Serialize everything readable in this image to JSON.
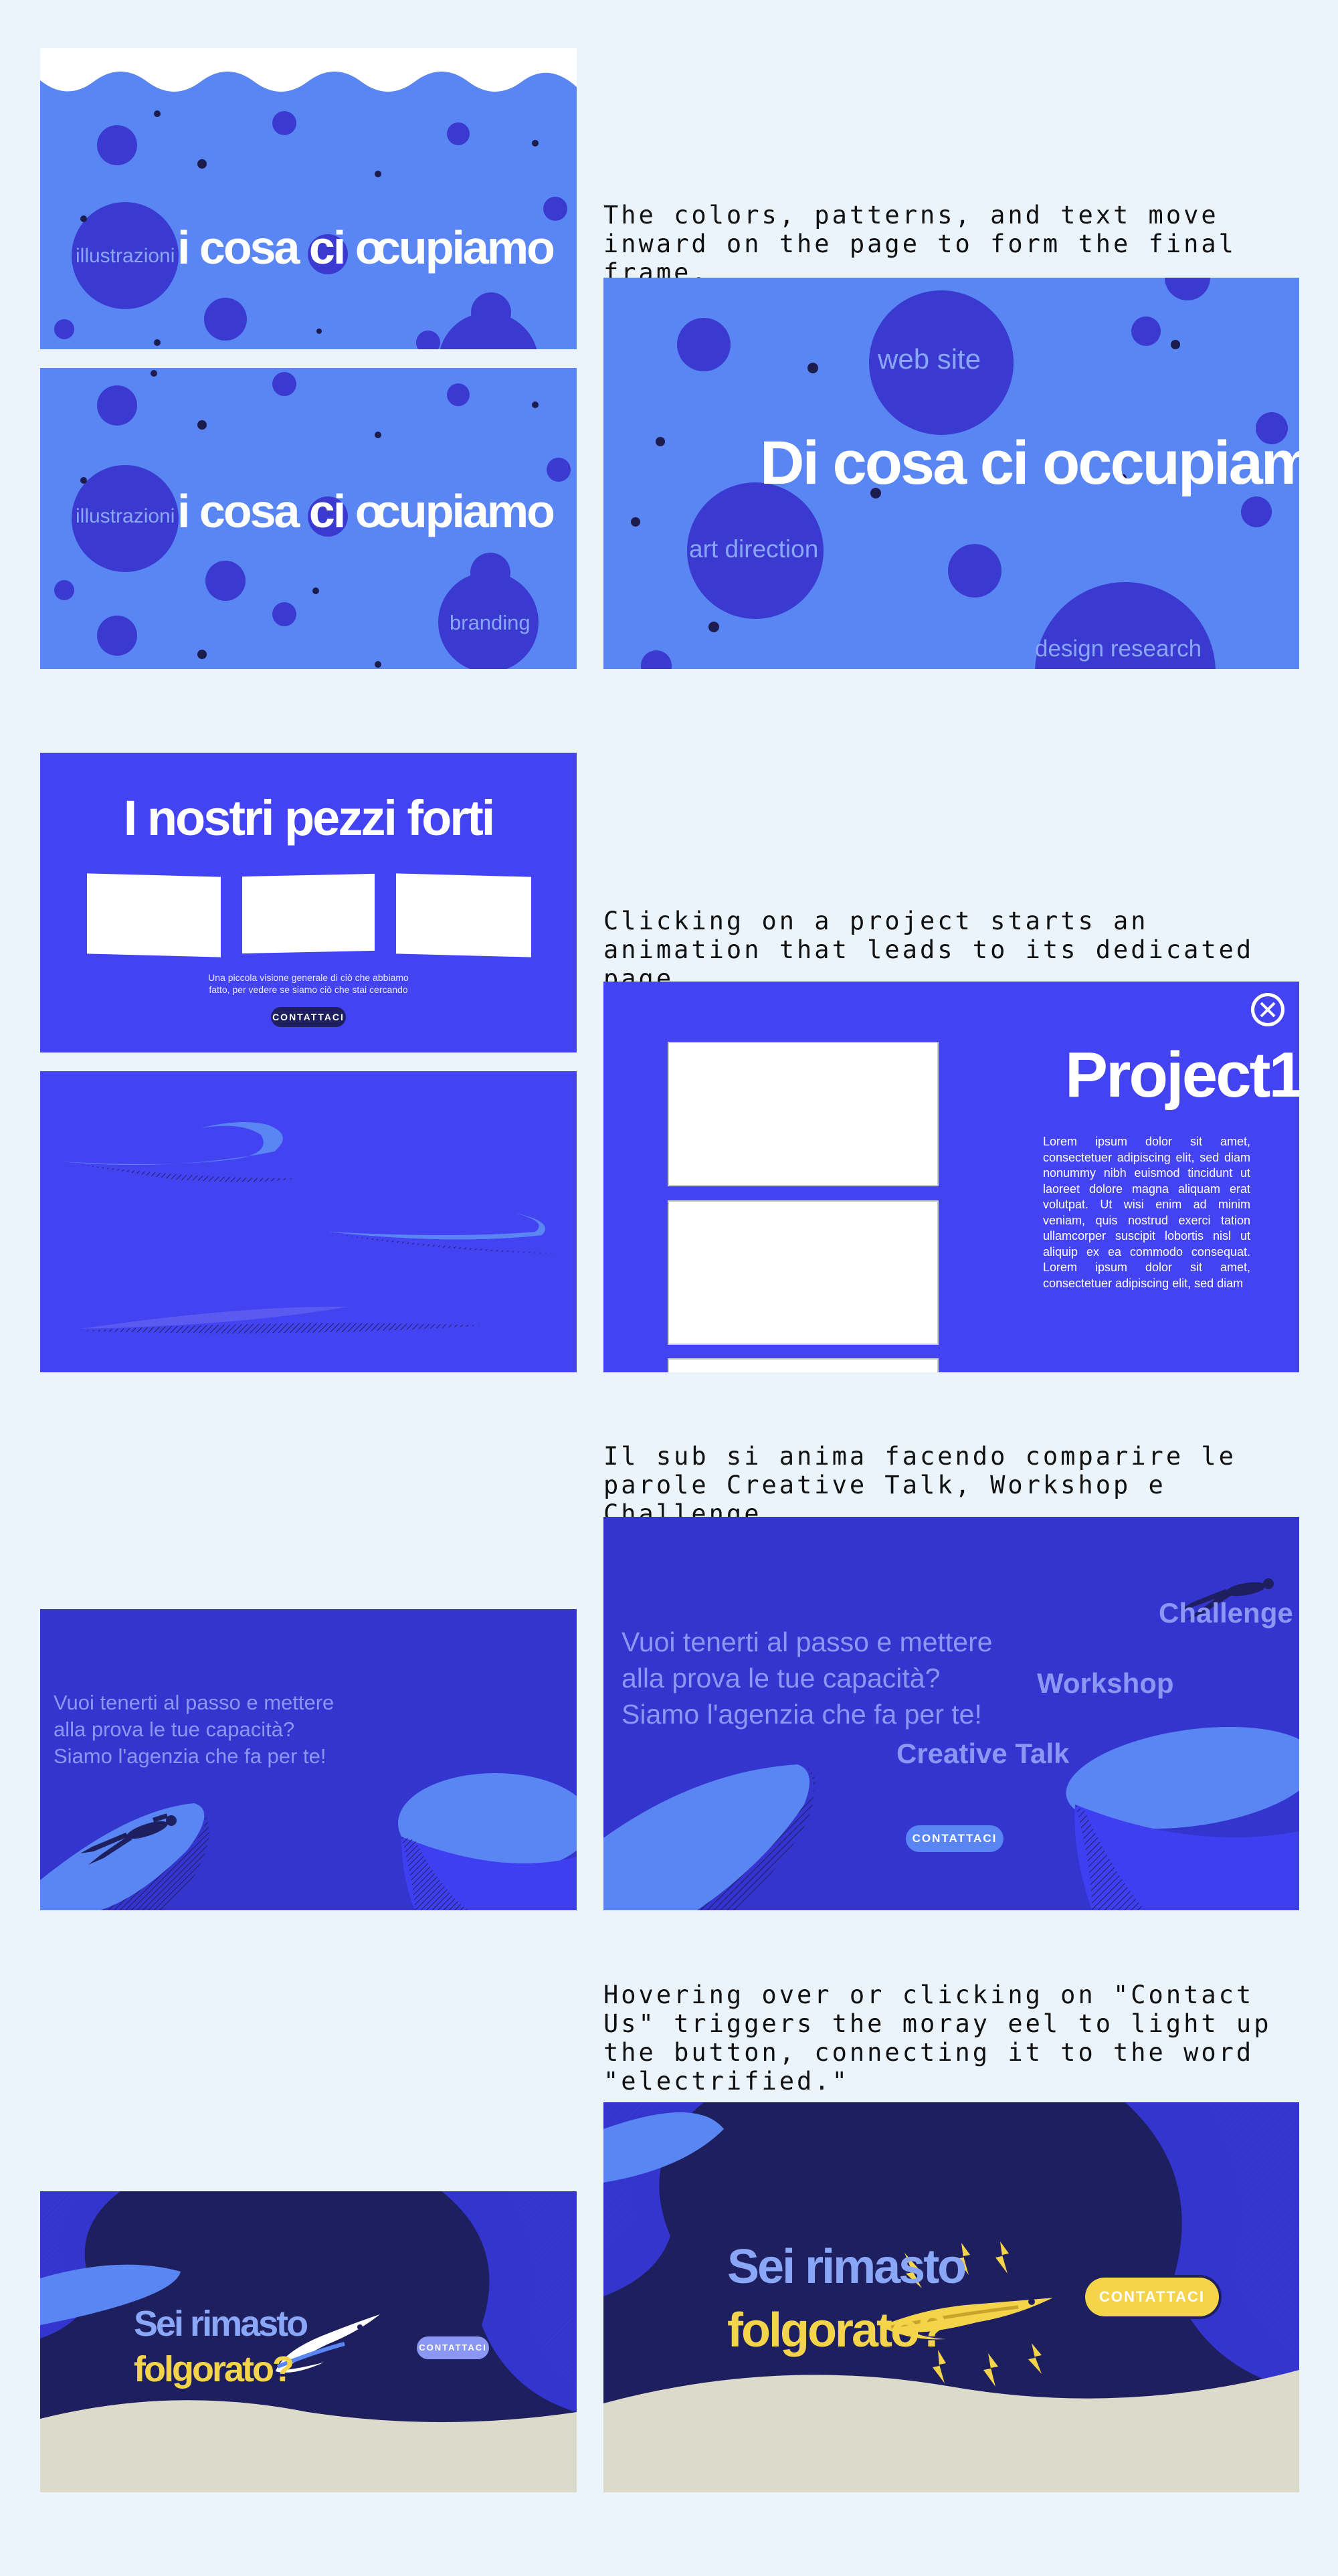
{
  "colors": {
    "page_bg": "#ecf4fb",
    "blue_light": "#5a86f4",
    "blue_medium": "#4343f2",
    "blue_deep": "#3434cf",
    "navy": "#1e1f5e",
    "bubble": "#3a3ad0",
    "dot": "#1c1c4e",
    "eel_yellow": "#f4d44a",
    "sand": "#dcdaca"
  },
  "captions": {
    "c1": "The colors, patterns, and text move inward on the page to form the final frame.",
    "c2": "Clicking on a project starts an animation that leads to its dedicated page.",
    "c3": "Il sub si anima facendo comparire le parole Creative Talk, Workshop e Challenge.",
    "c4": "Hovering over or clicking on \"Contact Us\" triggers the moray eel to light up the button, connecting it to the word \"electrified.\""
  },
  "section1": {
    "title": "Di cosa ci occupiamo",
    "title_partial": "i cosa ci o",
    "title_partial_end": "cupiamo",
    "words": {
      "illustrazioni": "illustrazioni",
      "branding": "branding",
      "web_site": "web site",
      "art_direction": "art direction",
      "design_research": "design research"
    }
  },
  "section2": {
    "title": "I nostri pezzi forti",
    "subtitle_line1": "Una piccola visione generale di ciò che abbiamo",
    "subtitle_line2": "fatto, per vedere se siamo ciò che stai cercando",
    "contact_label": "CONTATTACI",
    "project_title": "Project1",
    "lorem": "Lorem ipsum dolor sit amet, consectetuer adipiscing elit, sed diam nonummy nibh euismod tincidunt ut laoreet dolore magna aliquam erat volutpat. Ut wisi enim ad minim veniam, quis nostrud exerci tation ullamcorper suscipit lobortis nisl ut aliquip ex ea commodo consequat. Lorem ipsum dolor sit amet, consectetuer adipiscing elit, sed diam"
  },
  "section3": {
    "text_line1": "Vuoi tenerti al passo e mettere",
    "text_line2": "alla prova le tue capacità?",
    "text_line3": "Siamo l'agenzia che fa per te!",
    "challenge": "Challenge",
    "workshop": "Workshop",
    "creative_talk": "Creative Talk",
    "contact_label": "CONTATTACI"
  },
  "section4": {
    "line1": "Sei rimasto",
    "line2": "folgorato?",
    "contact_label": "CONTATTACI"
  },
  "icons": {
    "close": "close-circle-x",
    "diver": "scuba-diver-silhouette",
    "eel": "moray-eel",
    "lightning": "lightning-bolt"
  }
}
